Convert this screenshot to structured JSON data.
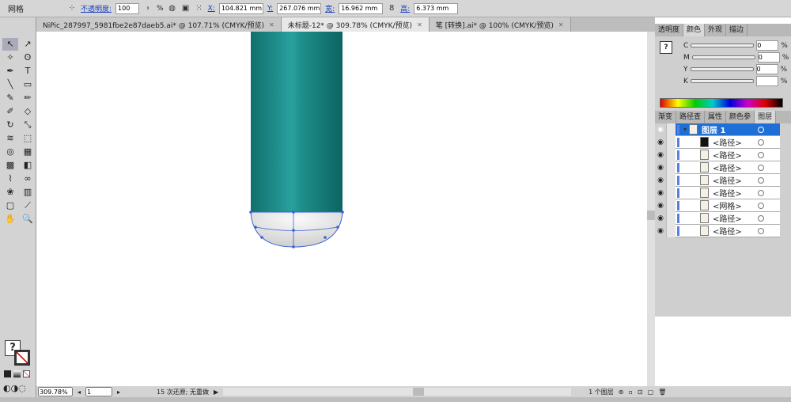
{
  "control_bar": {
    "object_type": "网格",
    "opacity_label": "不透明度:",
    "opacity_value": "100",
    "opacity_unit": "%",
    "x_label": "X:",
    "x_value": "104.821 mm",
    "y_label": "Y:",
    "y_value": "267.076 mm",
    "w_label": "宽:",
    "w_value": "16.962 mm",
    "h_label": "高:",
    "h_value": "6.373 mm"
  },
  "doc_tabs": [
    {
      "label": "NiPic_287997_5981fbe2e87daeb5.ai* @ 107.71% (CMYK/预览)",
      "active": false
    },
    {
      "label": "未标题-12* @ 309.78% (CMYK/预览)",
      "active": true
    },
    {
      "label": "笔 [转换].ai* @ 100% (CMYK/预览)",
      "active": false
    }
  ],
  "tools": [
    "selection",
    "direct-selection",
    "magic-wand",
    "lasso",
    "pen",
    "type",
    "line",
    "rectangle",
    "paintbrush",
    "pencil",
    "blob-brush",
    "eraser",
    "rotate",
    "scale",
    "warp",
    "free-transform",
    "shape-builder",
    "perspective",
    "mesh",
    "gradient",
    "eyedropper",
    "blend",
    "symbol-sprayer",
    "column-graph",
    "artboard",
    "slice",
    "hand",
    "zoom"
  ],
  "color_panel": {
    "tabs": [
      "透明度",
      "颜色",
      "外观",
      "描边"
    ],
    "active_tab": "颜色",
    "channels": [
      {
        "label": "C",
        "value": "0"
      },
      {
        "label": "M",
        "value": "0"
      },
      {
        "label": "Y",
        "value": "0"
      },
      {
        "label": "K",
        "value": ""
      }
    ],
    "unit": "%"
  },
  "layers_panel": {
    "tabs": [
      "渐变",
      "路径查",
      "属性",
      "颜色参",
      "图层"
    ],
    "active_tab": "图层",
    "layer": "图层 1",
    "items": [
      "<路径>",
      "<路径>",
      "<路径>",
      "<路径>",
      "<路径>",
      "<网格>",
      "<路径>",
      "<路径>"
    ],
    "count_label": "1 个图层"
  },
  "status": {
    "zoom": "309.78%",
    "artboard": "1",
    "undo": "15 次还原; 无重做"
  },
  "colors": {
    "teal": "#1a8a88",
    "selection": "#3a5fd8",
    "layer_highlight": "#1e6fd6"
  }
}
